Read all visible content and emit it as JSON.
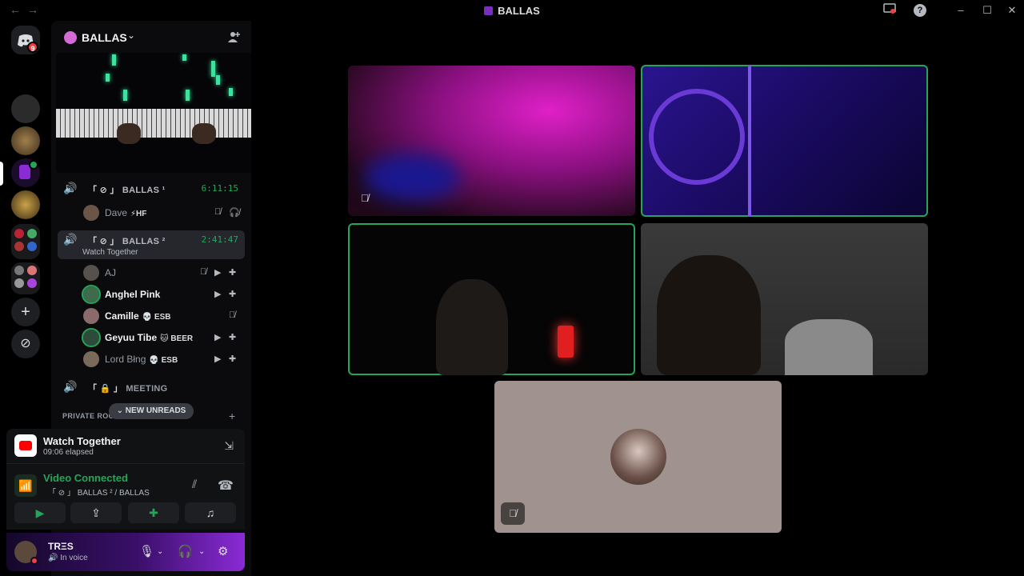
{
  "window": {
    "title": "BALLAS",
    "back_glyph": "←",
    "forward_glyph": "→",
    "help_glyph": "?",
    "minimize_glyph": "–",
    "maximize_glyph": "☐",
    "close_glyph": "✕"
  },
  "rail": {
    "home_badge": "9",
    "add_glyph": "+",
    "discover_glyph": "⊘"
  },
  "server": {
    "name": "BALLAS",
    "chevron": "⌄",
    "invite_glyph": "⊕"
  },
  "voice_channels": [
    {
      "bracket": "「 ⊘ 」",
      "name": "BALLAS ¹",
      "time": "6:11:15",
      "users": [
        {
          "name": "Dave",
          "tag": "⚡HF",
          "bright": false
        }
      ]
    },
    {
      "bracket": "「 ⊘ 」",
      "name": "BALLAS ²",
      "time": "2:41:47",
      "activity": "Watch Together",
      "users": [
        {
          "name": "AJ",
          "tag": "",
          "bright": false
        },
        {
          "name": "Anghel Pink",
          "tag": "",
          "bright": true
        },
        {
          "name": "Camille",
          "tag": "💀 ESB",
          "bright": true
        },
        {
          "name": "Geyuu Tibe",
          "tag": "🐱 BEER",
          "bright": true
        },
        {
          "name": "Lord Błng",
          "tag": "💀 ESB",
          "bright": false
        }
      ]
    },
    {
      "bracket": "「 🔒 」",
      "name": "MEETING"
    }
  ],
  "private_rooms": {
    "label": "PRIVATE ROO",
    "new_unreads": "⌄ NEW UNREADS",
    "add_glyph": "+"
  },
  "watch_together": {
    "title": "Watch Together",
    "elapsed": "09:06 elapsed"
  },
  "voice_status": {
    "title": "Video Connected",
    "channel": "「 ⊘ 」 BALLAS ² / BALLAS"
  },
  "user": {
    "name": "TRΞS",
    "status": "🔊 In voice"
  },
  "colors": {
    "accent_green": "#23a55a",
    "panel_bg": "#111214",
    "sidebar_bg": "#0b0b0d",
    "user_panel_gradient_end": "#8a2bd6"
  }
}
